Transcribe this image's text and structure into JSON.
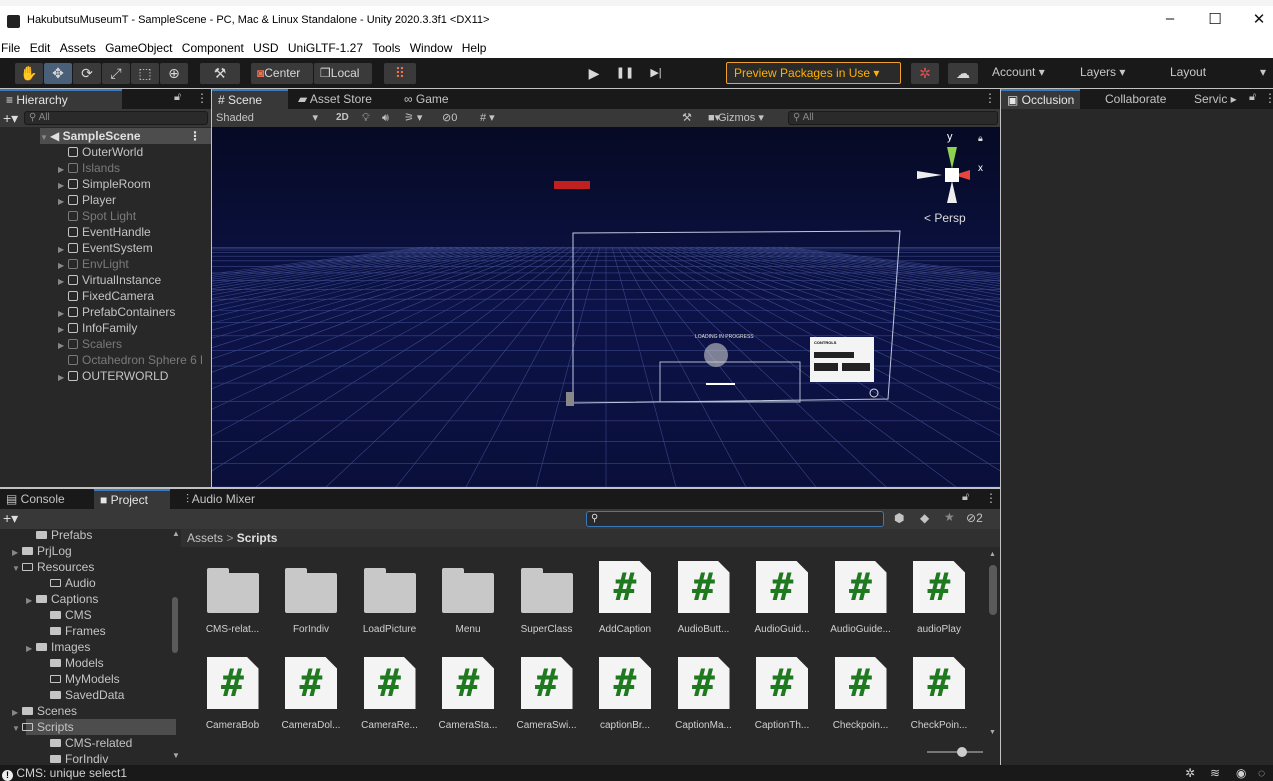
{
  "window": {
    "title": "HakubutsuMuseumT - SampleScene - PC, Mac & Linux Standalone - Unity 2020.3.3f1 <DX11>",
    "min": "–",
    "max": "☐",
    "close": "✕"
  },
  "menu": [
    "File",
    "Edit",
    "Assets",
    "GameObject",
    "Component",
    "USD",
    "UniGLTF-1.27",
    "Tools",
    "Window",
    "Help"
  ],
  "toolbar": {
    "tools": [
      "✋",
      "✥",
      "⟳",
      "⤢",
      "⬚",
      "⊕",
      "⚒"
    ],
    "pivot": "Center",
    "space": "Local",
    "snap": "⠿",
    "play": "▶",
    "pause": "❚❚",
    "step": "▶|",
    "preview": "Preview Packages in Use ▾",
    "account": "Account",
    "layers": "Layers",
    "layout": "Layout"
  },
  "hierarchy": {
    "tab": "Hierarchy",
    "search_placeholder": "All",
    "scene": "SampleScene",
    "items": [
      {
        "label": "OuterWorld",
        "arrow": false,
        "muted": false
      },
      {
        "label": "Islands",
        "arrow": true,
        "muted": true
      },
      {
        "label": "SimpleRoom",
        "arrow": true,
        "muted": false
      },
      {
        "label": "Player",
        "arrow": true,
        "muted": false
      },
      {
        "label": "Spot Light",
        "arrow": false,
        "muted": true
      },
      {
        "label": "EventHandle",
        "arrow": false,
        "muted": false
      },
      {
        "label": "EventSystem",
        "arrow": true,
        "muted": false
      },
      {
        "label": "EnvLight",
        "arrow": true,
        "muted": true
      },
      {
        "label": "VirtualInstance",
        "arrow": true,
        "muted": false
      },
      {
        "label": "FixedCamera",
        "arrow": false,
        "muted": false
      },
      {
        "label": "PrefabContainers",
        "arrow": true,
        "muted": false
      },
      {
        "label": "InfoFamily",
        "arrow": true,
        "muted": false
      },
      {
        "label": "Scalers",
        "arrow": true,
        "muted": true
      },
      {
        "label": "Octahedron Sphere 6 l",
        "arrow": false,
        "muted": true
      },
      {
        "label": "OUTERWORLD",
        "arrow": true,
        "muted": false
      }
    ]
  },
  "scene": {
    "tabs": [
      "Scene",
      "Asset Store",
      "Game"
    ],
    "shading": "Shaded",
    "mode2d": "2D",
    "hidden_count": "0",
    "gizmos": "Gizmos",
    "search_placeholder": "All",
    "persp": "Persp",
    "axis_y": "y",
    "axis_x": "x",
    "canvas_text_1": "LOADING IN PROGRESS",
    "canvas_text_2": "CONTROLS"
  },
  "inspector_tabs": [
    "Occlusion",
    "Collaborate",
    "Servic"
  ],
  "project": {
    "tabs": [
      "Console",
      "Project",
      "Audio Mixer"
    ],
    "breadcrumb_root": "Assets",
    "breadcrumb_sep": ">",
    "breadcrumb_leaf": "Scripts",
    "hidden_count": "2",
    "tree": [
      {
        "label": "Prefabs",
        "indent": 1,
        "arrow": "",
        "open": false
      },
      {
        "label": "PrjLog",
        "indent": 0,
        "arrow": "▶",
        "open": false
      },
      {
        "label": "Resources",
        "indent": 0,
        "arrow": "▼",
        "open": true
      },
      {
        "label": "Audio",
        "indent": 2,
        "arrow": "",
        "open": true
      },
      {
        "label": "Captions",
        "indent": 1,
        "arrow": "▶",
        "open": false
      },
      {
        "label": "CMS",
        "indent": 2,
        "arrow": "",
        "open": false
      },
      {
        "label": "Frames",
        "indent": 2,
        "arrow": "",
        "open": false
      },
      {
        "label": "Images",
        "indent": 1,
        "arrow": "▶",
        "open": false
      },
      {
        "label": "Models",
        "indent": 2,
        "arrow": "",
        "open": false
      },
      {
        "label": "MyModels",
        "indent": 2,
        "arrow": "",
        "open": true
      },
      {
        "label": "SavedData",
        "indent": 2,
        "arrow": "",
        "open": false
      },
      {
        "label": "Scenes",
        "indent": 0,
        "arrow": "▶",
        "open": false
      },
      {
        "label": "Scripts",
        "indent": 0,
        "arrow": "▼",
        "open": true
      },
      {
        "label": "CMS-related",
        "indent": 2,
        "arrow": "",
        "open": false
      },
      {
        "label": "ForIndiv",
        "indent": 2,
        "arrow": "",
        "open": false
      }
    ],
    "assets_row1": [
      {
        "label": "CMS-relat...",
        "kind": "folder"
      },
      {
        "label": "ForIndiv",
        "kind": "folder"
      },
      {
        "label": "LoadPicture",
        "kind": "folder"
      },
      {
        "label": "Menu",
        "kind": "folder"
      },
      {
        "label": "SuperClass",
        "kind": "folder"
      },
      {
        "label": "AddCaption",
        "kind": "script"
      },
      {
        "label": "AudioButt...",
        "kind": "script"
      },
      {
        "label": "AudioGuid...",
        "kind": "script"
      },
      {
        "label": "AudioGuide...",
        "kind": "script"
      },
      {
        "label": "audioPlay",
        "kind": "script"
      }
    ],
    "assets_row2": [
      {
        "label": "CameraBob",
        "kind": "script"
      },
      {
        "label": "CameraDol...",
        "kind": "script"
      },
      {
        "label": "CameraRe...",
        "kind": "script"
      },
      {
        "label": "CameraSta...",
        "kind": "script"
      },
      {
        "label": "CameraSwi...",
        "kind": "script"
      },
      {
        "label": "captionBr...",
        "kind": "script"
      },
      {
        "label": "CaptionMa...",
        "kind": "script"
      },
      {
        "label": "CaptionTh...",
        "kind": "script"
      },
      {
        "label": "Checkpoin...",
        "kind": "script"
      },
      {
        "label": "CheckPoin...",
        "kind": "script"
      }
    ],
    "script_glyph": "#"
  },
  "status": {
    "message": "CMS: unique select1"
  },
  "colors": {
    "accent": "#3a79bb",
    "warning": "#ffb100",
    "script_hash": "#1f7a1f",
    "scene_bg": "#0d1350"
  }
}
